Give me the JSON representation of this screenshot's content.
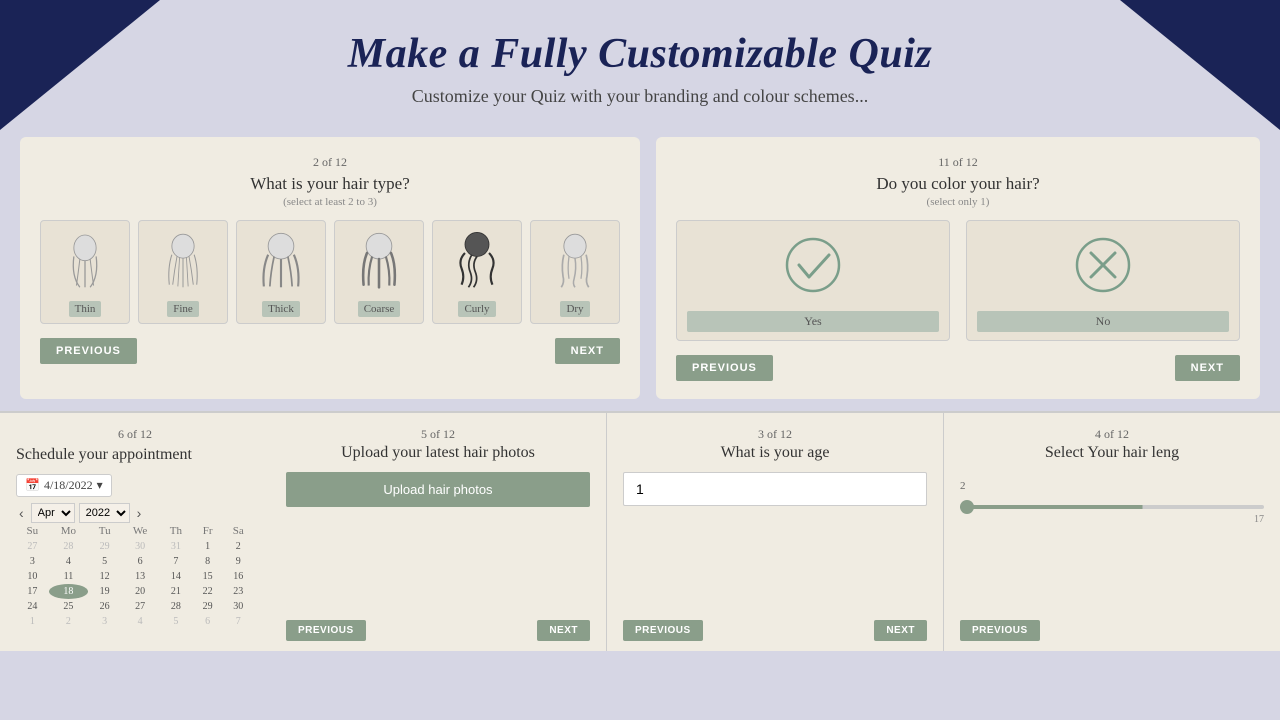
{
  "header": {
    "title": "Make a Fully Customizable Quiz",
    "subtitle": "Customize your Quiz with your branding and colour schemes..."
  },
  "card_top_left": {
    "step": "2 of 12",
    "question": "What is your hair type?",
    "sub": "(select at least 2 to 3)",
    "options": [
      "Thin",
      "Fine",
      "Thick",
      "Coarse",
      "Curly",
      "Dry"
    ],
    "prev_label": "PREVIOUS",
    "next_label": "NEXT"
  },
  "card_top_right": {
    "step": "11 of 12",
    "question": "Do you color your hair?",
    "sub": "(select only 1)",
    "yes_label": "Yes",
    "no_label": "No",
    "prev_label": "PREVIOUS",
    "next_label": "NEXT"
  },
  "card_bottom_schedule": {
    "step": "6 of 12",
    "question": "Schedule your appointment",
    "date_value": "4/18/2022",
    "month": "Apr",
    "year": "2022",
    "days": [
      "Su",
      "Mo",
      "Tu",
      "We",
      "Th",
      "Fr",
      "Sa"
    ],
    "weeks": [
      [
        "27",
        "28",
        "29",
        "30",
        "31",
        "1",
        "2"
      ],
      [
        "3",
        "4",
        "5",
        "6",
        "7",
        "8",
        "9"
      ],
      [
        "10",
        "11",
        "12",
        "13",
        "14",
        "15",
        "16"
      ],
      [
        "17",
        "18",
        "19",
        "20",
        "21",
        "22",
        "23"
      ],
      [
        "24",
        "25",
        "26",
        "27",
        "28",
        "29",
        "30"
      ],
      [
        "1",
        "2",
        "3",
        "4",
        "5",
        "6",
        "7"
      ]
    ],
    "today_row": 3,
    "today_col": 1
  },
  "card_bottom_upload": {
    "step": "5 of 12",
    "question": "Upload your latest hair photos",
    "upload_btn": "Upload hair photos",
    "prev_label": "PREVIOUS",
    "next_label": "NEXT"
  },
  "card_bottom_age": {
    "step": "3 of 12",
    "question": "What is your age",
    "placeholder": "1",
    "prev_label": "PREVIOUS",
    "next_label": "NEXT"
  },
  "card_bottom_length": {
    "step": "4 of 12",
    "question": "Select Your hair leng",
    "slider_value": 2,
    "slider_min": 2,
    "slider_max": 17,
    "prev_label": "PREVIOUS"
  }
}
